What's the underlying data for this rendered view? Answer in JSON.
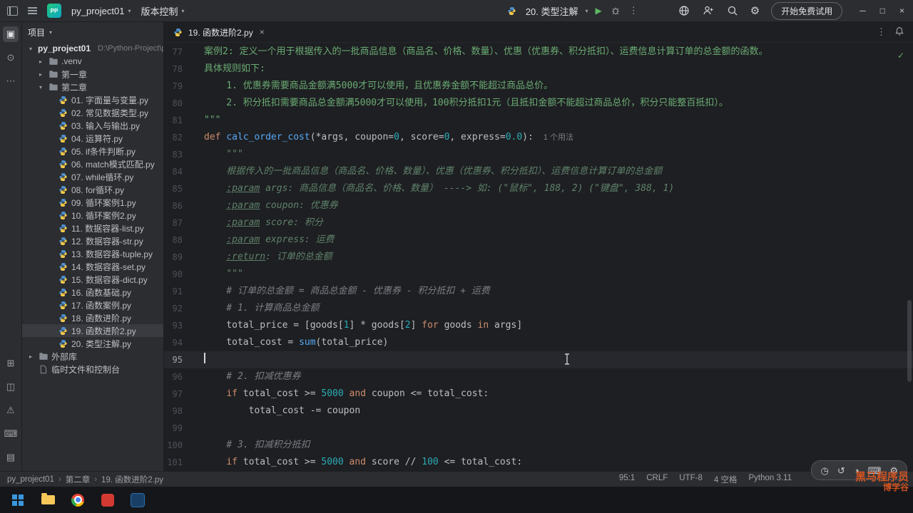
{
  "titlebar": {
    "logo": "PP",
    "project_menu": "py_project01",
    "vcs_menu": "版本控制",
    "run_config": "20. 类型注解",
    "trial_button": "开始免费试用",
    "right_icons": [
      "globe-icon",
      "add-user-icon",
      "search-icon",
      "settings-icon"
    ]
  },
  "icons": {
    "chevron_down": "▾",
    "chevron_right": "▸",
    "more_h": "⋯",
    "more_v": "⋮",
    "play": "▶",
    "check": "✓",
    "minimize": "─",
    "maximize": "□",
    "close": "×",
    "gear": "⚙",
    "breadcrumb_sep": "›"
  },
  "stripe": {
    "top": [
      {
        "name": "project-icon",
        "glyph": "▣",
        "active": true
      },
      {
        "name": "commit-icon",
        "glyph": "⊙"
      },
      {
        "name": "more-tool-windows-icon",
        "glyph": "⋯"
      }
    ],
    "bottom": [
      {
        "name": "services-icon",
        "glyph": "⊞"
      },
      {
        "name": "python-console-icon",
        "glyph": "◫"
      },
      {
        "name": "problems-icon",
        "glyph": "⚠"
      },
      {
        "name": "terminal-icon",
        "glyph": "⌨"
      },
      {
        "name": "structure-icon",
        "glyph": "▤"
      }
    ]
  },
  "project": {
    "header": "项目",
    "tree": [
      {
        "depth": 0,
        "chevron": "down",
        "icon": null,
        "label": "py_project01",
        "bold": true,
        "extra": "D:\\Python-Project\\py_"
      },
      {
        "depth": 1,
        "chevron": "right",
        "icon": "folder",
        "label": ".venv"
      },
      {
        "depth": 1,
        "chevron": "right",
        "icon": "folder",
        "label": "第一章"
      },
      {
        "depth": 1,
        "chevron": "down",
        "icon": "folder",
        "label": "第二章"
      },
      {
        "depth": 2,
        "icon": "py",
        "label": "01. 字面量与变量.py"
      },
      {
        "depth": 2,
        "icon": "py",
        "label": "02. 常见数据类型.py"
      },
      {
        "depth": 2,
        "icon": "py",
        "label": "03. 输入与输出.py"
      },
      {
        "depth": 2,
        "icon": "py",
        "label": "04. 运算符.py"
      },
      {
        "depth": 2,
        "icon": "py",
        "label": "05. if条件判断.py"
      },
      {
        "depth": 2,
        "icon": "py",
        "label": "06. match模式匹配.py"
      },
      {
        "depth": 2,
        "icon": "py",
        "label": "07. while循环.py"
      },
      {
        "depth": 2,
        "icon": "py",
        "label": "08. for循环.py"
      },
      {
        "depth": 2,
        "icon": "py",
        "label": "09. 循环案例1.py"
      },
      {
        "depth": 2,
        "icon": "py",
        "label": "10. 循环案例2.py"
      },
      {
        "depth": 2,
        "icon": "py",
        "label": "11. 数据容器-list.py"
      },
      {
        "depth": 2,
        "icon": "py",
        "label": "12. 数据容器-str.py"
      },
      {
        "depth": 2,
        "icon": "py",
        "label": "13. 数据容器-tuple.py"
      },
      {
        "depth": 2,
        "icon": "py",
        "label": "14. 数据容器-set.py"
      },
      {
        "depth": 2,
        "icon": "py",
        "label": "15. 数据容器-dict.py"
      },
      {
        "depth": 2,
        "icon": "py",
        "label": "16. 函数基础.py"
      },
      {
        "depth": 2,
        "icon": "py",
        "label": "17. 函数案例.py"
      },
      {
        "depth": 2,
        "icon": "py",
        "label": "18. 函数进阶.py"
      },
      {
        "depth": 2,
        "icon": "py",
        "label": "19. 函数进阶2.py",
        "selected": true
      },
      {
        "depth": 2,
        "icon": "py",
        "label": "20. 类型注解.py"
      },
      {
        "depth": 0,
        "chevron": "right",
        "icon": "folder",
        "label": "外部库"
      },
      {
        "depth": 0,
        "icon": "scratch",
        "label": "临时文件和控制台"
      }
    ]
  },
  "editor": {
    "tab": {
      "label": "19. 函数进阶2.py"
    },
    "lines": [
      {
        "no": "77",
        "seg": [
          [
            "s",
            "案例2: 定义一个用于根据传入的一批商品信息（商品名、价格、数量）、优惠（优惠券、积分抵扣）、运费信息计算订单的总金额的函数。"
          ]
        ]
      },
      {
        "no": "78",
        "seg": [
          [
            "s",
            "具体规则如下:"
          ]
        ]
      },
      {
        "no": "79",
        "seg": [
          [
            "s",
            "    1. 优惠券需要商品金额满5000才可以使用，且优惠券金额不能超过商品总价。"
          ]
        ]
      },
      {
        "no": "80",
        "seg": [
          [
            "s",
            "    2. 积分抵扣需要商品总金额满5000才可以使用，100积分抵扣1元（且抵扣金额不能超过商品总价，积分只能整百抵扣）。"
          ]
        ]
      },
      {
        "no": "81",
        "seg": [
          [
            "s",
            "\"\"\""
          ]
        ]
      },
      {
        "no": "82",
        "seg": [
          [
            "k",
            "def "
          ],
          [
            "f",
            "calc_order_cost"
          ],
          [
            "d",
            "(*args, coupon="
          ],
          [
            "n",
            "0"
          ],
          [
            "d",
            ", score="
          ],
          [
            "n",
            "0"
          ],
          [
            "d",
            ", express="
          ],
          [
            "n",
            "0.0"
          ],
          [
            "d",
            "):"
          ],
          [
            "i",
            "1 个用法"
          ]
        ]
      },
      {
        "no": "83",
        "seg": [
          [
            "g",
            "    \"\"\""
          ]
        ]
      },
      {
        "no": "84",
        "seg": [
          [
            "g",
            "    根据传入的一批商品信息（商品名、价格、数量）、优惠（优惠券、积分抵扣）、运费信息计算订单的总金额"
          ]
        ]
      },
      {
        "no": "85",
        "seg": [
          [
            "g",
            "    "
          ],
          [
            "t",
            ":param"
          ],
          [
            "g",
            " args: 商品信息（商品名、价格、数量） ----> 如: (\"鼠标\", 188, 2) (\"键盘\", 388, 1)"
          ]
        ]
      },
      {
        "no": "86",
        "seg": [
          [
            "g",
            "    "
          ],
          [
            "t",
            ":param"
          ],
          [
            "g",
            " coupon: 优惠券"
          ]
        ]
      },
      {
        "no": "87",
        "seg": [
          [
            "g",
            "    "
          ],
          [
            "t",
            ":param"
          ],
          [
            "g",
            " score: 积分"
          ]
        ]
      },
      {
        "no": "88",
        "seg": [
          [
            "g",
            "    "
          ],
          [
            "t",
            ":param"
          ],
          [
            "g",
            " express: 运费"
          ]
        ]
      },
      {
        "no": "89",
        "seg": [
          [
            "g",
            "    "
          ],
          [
            "t",
            ":return"
          ],
          [
            "g",
            ": 订单的总金额"
          ]
        ]
      },
      {
        "no": "90",
        "seg": [
          [
            "g",
            "    \"\"\""
          ]
        ]
      },
      {
        "no": "91",
        "seg": [
          [
            "c",
            "    # 订单的总金额 = 商品总金额 - 优惠券 - 积分抵扣 + 运费"
          ]
        ]
      },
      {
        "no": "92",
        "seg": [
          [
            "c",
            "    # 1. 计算商品总金额"
          ]
        ]
      },
      {
        "no": "93",
        "seg": [
          [
            "d",
            "    total_price = [goods["
          ],
          [
            "n",
            "1"
          ],
          [
            "d",
            "] * goods["
          ],
          [
            "n",
            "2"
          ],
          [
            "d",
            "] "
          ],
          [
            "k",
            "for"
          ],
          [
            "d",
            " goods "
          ],
          [
            "k",
            "in"
          ],
          [
            "d",
            " args]"
          ]
        ]
      },
      {
        "no": "94",
        "seg": [
          [
            "d",
            "    total_cost = "
          ],
          [
            "b",
            "sum"
          ],
          [
            "d",
            "(total_price)"
          ]
        ]
      },
      {
        "no": "95",
        "current": true,
        "seg": []
      },
      {
        "no": "96",
        "seg": [
          [
            "c",
            "    # 2. 扣减优惠券"
          ]
        ]
      },
      {
        "no": "97",
        "seg": [
          [
            "d",
            "    "
          ],
          [
            "k",
            "if"
          ],
          [
            "d",
            " total_cost >= "
          ],
          [
            "n",
            "5000"
          ],
          [
            "d",
            " "
          ],
          [
            "k",
            "and"
          ],
          [
            "d",
            " coupon <= total_cost:"
          ]
        ]
      },
      {
        "no": "98",
        "seg": [
          [
            "d",
            "        total_cost -= coupon"
          ]
        ]
      },
      {
        "no": "99",
        "seg": []
      },
      {
        "no": "100",
        "seg": [
          [
            "c",
            "    # 3. 扣减积分抵扣"
          ]
        ]
      },
      {
        "no": "101",
        "seg": [
          [
            "d",
            "    "
          ],
          [
            "k",
            "if"
          ],
          [
            "d",
            " total_cost >= "
          ],
          [
            "n",
            "5000"
          ],
          [
            "d",
            " "
          ],
          [
            "k",
            "and"
          ],
          [
            "d",
            " score // "
          ],
          [
            "n",
            "100"
          ],
          [
            "d",
            " <= total_cost:"
          ]
        ]
      }
    ]
  },
  "status": {
    "breadcrumbs": [
      "py_project01",
      "第二章",
      "19. 函数进阶2.py"
    ],
    "right": [
      "95:1",
      "CRLF",
      "UTF-8",
      "4 空格",
      "Python 3.11"
    ]
  },
  "recorder": {
    "icons": [
      {
        "name": "timer-icon",
        "glyph": "◷"
      },
      {
        "name": "undo-icon",
        "glyph": "↺"
      },
      {
        "name": "pause-icon",
        "glyph": "◑"
      },
      {
        "name": "keyboard-icon",
        "glyph": "⌨"
      },
      {
        "name": "settings-icon",
        "glyph": "⚙"
      }
    ]
  },
  "taskbar": {
    "items": [
      {
        "name": "start-button",
        "kind": "windows"
      },
      {
        "name": "explorer-icon",
        "kind": "folder"
      },
      {
        "name": "chrome-icon",
        "kind": "chrome"
      },
      {
        "name": "music-app-icon",
        "kind": "red"
      },
      {
        "name": "ide-app-icon",
        "kind": "blue"
      }
    ]
  },
  "watermark": {
    "line1": "黑马程序员",
    "line2": "博学谷"
  }
}
